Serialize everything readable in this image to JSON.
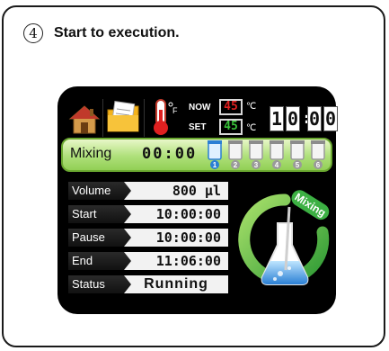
{
  "step": {
    "number": "4",
    "title": "Start to execution."
  },
  "header": {
    "icons": [
      "home-icon",
      "memo-icon",
      "thermometer-icon"
    ],
    "temperature": {
      "now_label": "NOW",
      "now_value": "45",
      "set_label": "SET",
      "set_value": "45",
      "unit": "℃",
      "now_color": "#e02020",
      "set_color": "#39c23a"
    },
    "clock": {
      "digits": [
        "1",
        "0",
        "0",
        "0"
      ],
      "separator": ":"
    }
  },
  "mixing_bar": {
    "label": "Mixing",
    "time": "00:00",
    "tubes": [
      "1",
      "2",
      "3",
      "4",
      "5",
      "6"
    ],
    "active_tube": "1",
    "active_color": "#2a7fd4"
  },
  "status_table": {
    "rows": [
      {
        "label": "Volume",
        "value": "800 µl"
      },
      {
        "label": "Start",
        "value": "10:00:00"
      },
      {
        "label": "Pause",
        "value": "10:00:00"
      },
      {
        "label": "End",
        "value": "11:06:00"
      },
      {
        "label": "Status",
        "value": "Running"
      }
    ]
  },
  "graphic": {
    "badge_text": "Mixing",
    "ring_color": "#3cb043",
    "icon": "flask-icon"
  }
}
